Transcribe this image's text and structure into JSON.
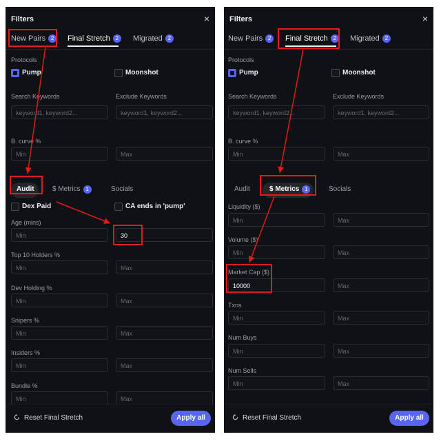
{
  "panel_left": {
    "title": "Filters",
    "close": "×",
    "tabs": [
      {
        "label": "New Pairs",
        "badge": "2"
      },
      {
        "label": "Final Stretch",
        "badge": "2"
      },
      {
        "label": "Migrated",
        "badge": "2"
      }
    ],
    "protocols_label": "Protocols",
    "protocols": [
      {
        "label": "Pump",
        "checked": true
      },
      {
        "label": "Moonshot",
        "checked": false
      }
    ],
    "search_keywords": {
      "label": "Search Keywords",
      "placeholder": "keyword1, keyword2..."
    },
    "exclude_keywords": {
      "label": "Exclude Keywords",
      "placeholder": "keyword1, keyword2..."
    },
    "bcurve": {
      "label": "B. curve %",
      "min_placeholder": "Min",
      "max_placeholder": "Max"
    },
    "subtabs": [
      {
        "label": "Audit",
        "active": true
      },
      {
        "label": "$ Metrics",
        "badge": "1"
      },
      {
        "label": "Socials"
      }
    ],
    "audit_checks": [
      {
        "label": "Dex Paid",
        "checked": false
      },
      {
        "label": "CA ends in 'pump'",
        "checked": false
      }
    ],
    "audit_fields": [
      {
        "label": "Age (mins)",
        "min": "Min",
        "max": "30"
      },
      {
        "label": "Top 10 Holders %",
        "min": "Min",
        "max": "Max"
      },
      {
        "label": "Dev Holding %",
        "min": "Min",
        "max": "Max"
      },
      {
        "label": "Snipers %",
        "min": "Min",
        "max": "Max"
      },
      {
        "label": "Insiders %",
        "min": "Min",
        "max": "Max"
      },
      {
        "label": "Bundle %",
        "min": "Min",
        "max": "Max"
      }
    ],
    "reset_label": "Reset Final Stretch",
    "apply_label": "Apply all"
  },
  "panel_right": {
    "title": "Filters",
    "close": "×",
    "tabs": [
      {
        "label": "New Pairs",
        "badge": "2"
      },
      {
        "label": "Final Stretch",
        "badge": "2"
      },
      {
        "label": "Migrated",
        "badge": "2"
      }
    ],
    "protocols_label": "Protocols",
    "protocols": [
      {
        "label": "Pump",
        "checked": true
      },
      {
        "label": "Moonshot",
        "checked": false
      }
    ],
    "search_keywords": {
      "label": "Search Keywords",
      "placeholder": "keyword1, keyword2..."
    },
    "exclude_keywords": {
      "label": "Exclude Keywords",
      "placeholder": "keyword1, keyword2..."
    },
    "bcurve": {
      "label": "B. curve %",
      "min_placeholder": "Min",
      "max_placeholder": "Max"
    },
    "subtabs": [
      {
        "label": "Audit"
      },
      {
        "label": "$ Metrics",
        "badge": "1",
        "active": true
      },
      {
        "label": "Socials"
      }
    ],
    "metrics_fields": [
      {
        "label": "Liquidity ($)",
        "min": "Min",
        "max": "Max"
      },
      {
        "label": "Volume ($)",
        "min": "Min",
        "max": "Max"
      },
      {
        "label": "Market Cap ($)",
        "min": "10000",
        "max": "Max"
      },
      {
        "label": "Txns",
        "min": "Min",
        "max": "Max"
      },
      {
        "label": "Num Buys",
        "min": "Min",
        "max": "Max"
      },
      {
        "label": "Num Sells",
        "min": "Min",
        "max": "Max"
      }
    ],
    "reset_label": "Reset Final Stretch",
    "apply_label": "Apply all"
  },
  "colors": {
    "accent": "#5865f2",
    "panel_bg": "#101114",
    "annotation": "#e01b1b"
  }
}
